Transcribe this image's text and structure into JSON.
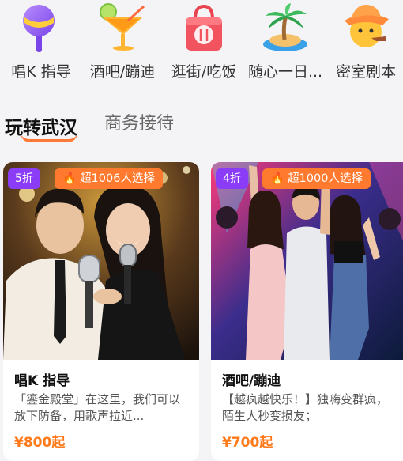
{
  "categories": [
    {
      "label": "唱K 指导",
      "icon": "microphone-icon"
    },
    {
      "label": "酒吧/蹦迪",
      "icon": "cocktail-icon"
    },
    {
      "label": "逛街/吃饭",
      "icon": "shopping-bag-icon"
    },
    {
      "label": "随心一日...",
      "icon": "palm-island-icon"
    },
    {
      "label": "密室剧本",
      "icon": "detective-hat-icon"
    }
  ],
  "tabs": {
    "active": "玩转武汉",
    "inactive": "商务接待"
  },
  "cards": [
    {
      "discount": "5折",
      "hot": "超1006人选择",
      "title": "唱K 指导",
      "desc": "「鎏金殿堂」在这里，我们可以放下防备，用歌声拉近...",
      "price": "¥800起",
      "photo": "karaoke-couple-photo"
    },
    {
      "discount": "4折",
      "hot": "超1000人选择",
      "title": "酒吧/蹦迪",
      "desc": "【越疯越快乐！】独嗨变群疯，陌生人秒变损友；",
      "price": "¥700起",
      "photo": "nightclub-dance-photo"
    }
  ],
  "colors": {
    "accent": "#ff7a2e",
    "discount_bg": "#8b3cf6",
    "price": "#ff7a1a"
  }
}
